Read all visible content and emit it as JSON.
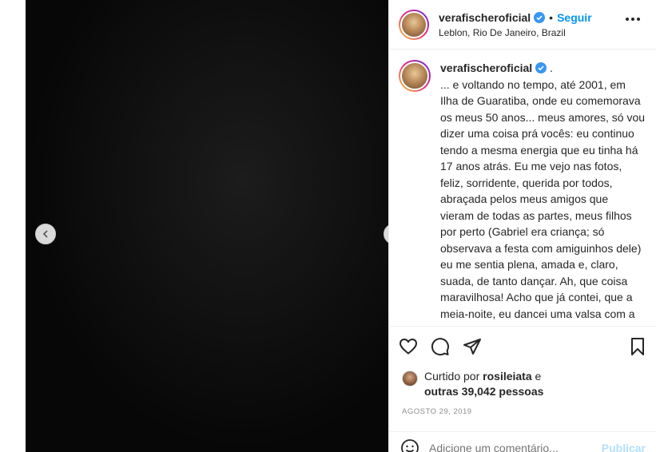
{
  "post": {
    "username": "verafischeroficial",
    "follow_label": "Seguir",
    "dot": "•",
    "location": "Leblon, Rio De Janeiro, Brazil",
    "caption_suffix": " .",
    "caption": "... e voltando no tempo, até 2001, em Ilha de Guaratiba, onde eu comemorava os meus 50 anos... meus amores, só vou dizer uma coisa prá vocês: eu continuo tendo a mesma energia que eu tinha há 17 anos atrás. Eu me vejo nas fotos, feliz, sorridente, querida por todos, abraçada pelos meus amigos que vieram de todas as partes, meus filhos por perto (Gabriel era criança; só observava a festa com amiguinhos dele) eu me sentia plena, amada e, claro, suada, de tanto dançar. Ah, que coisa maravilhosa! Acho que já contei, que a meia-noite, eu dancei uma valsa com a minha amada filha Rafaela. Nossa, como ela",
    "likes_prefix": "Curtido por ",
    "likes_user": "rosileiata",
    "likes_mid": " e",
    "likes_others": "outras 39,042 pessoas",
    "date": "AGOSTO 29, 2019",
    "comment_placeholder": "Adicione um comentário...",
    "publish_label": "Publicar"
  },
  "icons": {
    "verified": "verified-badge-icon",
    "more": "more-options-icon",
    "like": "heart-icon",
    "comment": "comment-icon",
    "share": "share-icon",
    "save": "bookmark-icon",
    "emoji": "emoji-icon",
    "prev": "chevron-left-icon",
    "next": "chevron-right-icon"
  },
  "colors": {
    "accent": "#0095f6",
    "publish_disabled": "#b2dffc",
    "muted": "#8e8e8e"
  }
}
